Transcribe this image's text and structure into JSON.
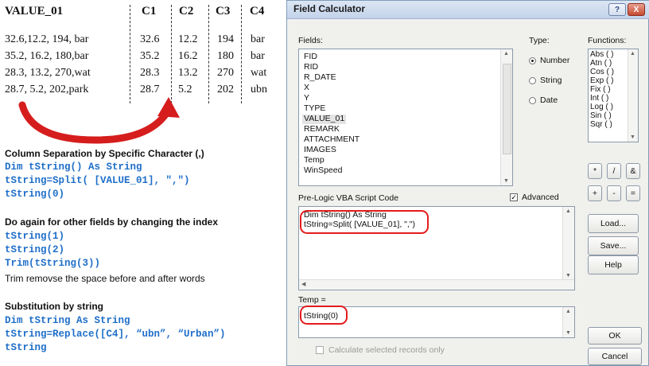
{
  "table": {
    "headers": [
      "VALUE_01",
      "C1",
      "C2",
      "C3",
      "C4"
    ],
    "rows": [
      {
        "value": "32.6,12.2, 194, bar",
        "c1": "32.6",
        "c2": "12.2",
        "c3": "194",
        "c4": "bar"
      },
      {
        "value": "35.2, 16.2, 180,bar",
        "c1": "35.2",
        "c2": "16.2",
        "c3": "180",
        "c4": "bar"
      },
      {
        "value": "28.3, 13.2, 270,wat",
        "c1": "28.3",
        "c2": "13.2",
        "c3": "270",
        "c4": "wat"
      },
      {
        "value": "28.7, 5.2, 202,park",
        "c1": "28.7",
        "c2": "5.2",
        "c3": "202",
        "c4": "ubn"
      }
    ]
  },
  "sections": {
    "split": {
      "heading": "Column Separation by Specific Character (,)",
      "code": [
        "Dim tString() As String",
        "tString=Split( [VALUE_01], \",\")",
        "tString(0)"
      ]
    },
    "index": {
      "heading": "Do again for other fields by changing the index",
      "code": [
        "tString(1)",
        "tString(2)",
        "Trim(tString(3))"
      ],
      "note": "Trim removse the space before and after words"
    },
    "replace": {
      "heading": "Substitution by string",
      "code": [
        "Dim tString As String",
        "tString=Replace([C4], “ubn”, “Urban”)",
        "tString"
      ]
    }
  },
  "dialog": {
    "title": "Field Calculator",
    "help_btn": "?",
    "close_btn": "X",
    "fields_label": "Fields:",
    "fields": [
      "FID",
      "RID",
      "R_DATE",
      "X",
      "Y",
      "TYPE",
      "VALUE_01",
      "REMARK",
      "ATTACHMENT",
      "IMAGES",
      "Temp",
      "WinSpeed"
    ],
    "selected_field": "VALUE_01",
    "type_label": "Type:",
    "types": [
      "Number",
      "String",
      "Date"
    ],
    "selected_type": "Number",
    "functions_label": "Functions:",
    "functions": [
      "Abs ( )",
      "Atn ( )",
      "Cos ( )",
      "Exp ( )",
      "Fix ( )",
      "Int ( )",
      "Log ( )",
      "Sin ( )",
      "Sqr ( )"
    ],
    "operators": [
      "*",
      "/",
      "&",
      "+",
      "-",
      "="
    ],
    "prelogic_label": "Pre-Logic VBA Script Code",
    "advanced_label": "Advanced",
    "advanced_checked": true,
    "prelogic_code": [
      "Dim tString() As String",
      "tString=Split( [VALUE_01], \",\")"
    ],
    "load_btn": "Load...",
    "save_btn": "Save...",
    "help_label": "Help",
    "temp_label": "Temp =",
    "expression": "tString(0)",
    "calc_selected_label": "Calculate selected records only",
    "ok_btn": "OK",
    "cancel_btn": "Cancel"
  }
}
